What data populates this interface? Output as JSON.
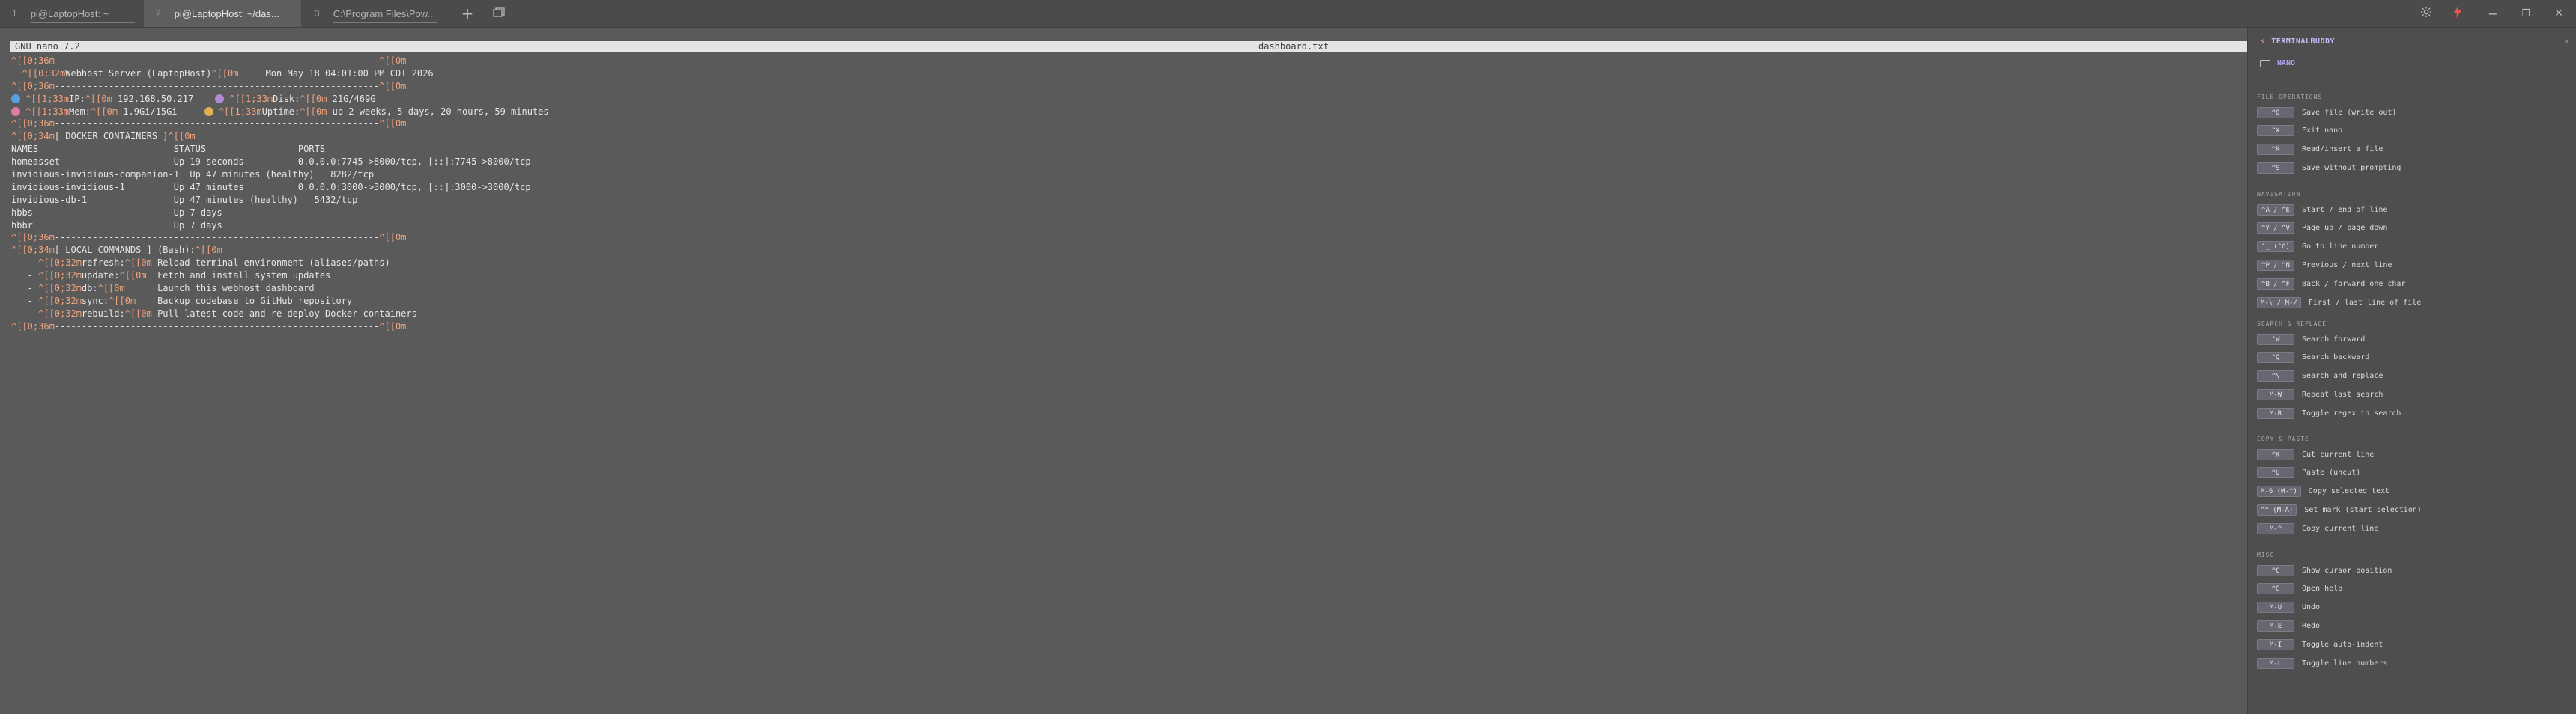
{
  "tabs": [
    {
      "num": "1",
      "title": "pi@LaptopHost: ~"
    },
    {
      "num": "2",
      "title": "pi@LaptopHost: ~/das..."
    },
    {
      "num": "3",
      "title": "C:\\Program Files\\Pow..."
    }
  ],
  "window": {
    "new_tab": "+",
    "minimize": "−",
    "maximize": "❐",
    "close": "✕"
  },
  "colors": {
    "escape_code": "#f2a37c",
    "accent_purple": "#b4a3f5",
    "bolt_orange": "#f0a26a",
    "terminal_bg": "#5a5a5a",
    "panel_bg": "#4e4e4e"
  },
  "nano": {
    "version": "GNU nano 7.2",
    "filename": "dashboard.txt"
  },
  "terminal_lines": [
    [
      {
        "t": "^[[0;36m",
        "e": 1
      },
      {
        "t": "------------------------------------------------------------"
      },
      {
        "t": "^[[0m",
        "e": 1
      }
    ],
    [
      {
        "t": "  ^[[0;32m",
        "e": 1
      },
      {
        "t": "Webhost Server (LaptopHost)"
      },
      {
        "t": "^[[0m",
        "e": 1
      },
      {
        "t": "     Mon May 18 04:01:00 PM CDT 2026"
      }
    ],
    [
      {
        "t": "^[[0;36m",
        "e": 1
      },
      {
        "t": "------------------------------------------------------------"
      },
      {
        "t": "^[[0m",
        "e": 1
      }
    ],
    [
      {
        "i": "#5aa0e0"
      },
      {
        "t": " "
      },
      {
        "t": "^[[1;33m",
        "e": 1
      },
      {
        "t": "IP:"
      },
      {
        "t": "^[[0m",
        "e": 1
      },
      {
        "t": " 192.168.50.217    "
      },
      {
        "i": "#b08ad0"
      },
      {
        "t": " "
      },
      {
        "t": "^[[1;33m",
        "e": 1
      },
      {
        "t": "Disk:"
      },
      {
        "t": "^[[0m",
        "e": 1
      },
      {
        "t": " 21G/469G"
      }
    ],
    [
      {
        "i": "#e07aa8"
      },
      {
        "t": " "
      },
      {
        "t": "^[[1;33m",
        "e": 1
      },
      {
        "t": "Mem:"
      },
      {
        "t": "^[[0m",
        "e": 1
      },
      {
        "t": " 1.9Gi/15Gi     "
      },
      {
        "i": "#e0b050"
      },
      {
        "t": " "
      },
      {
        "t": "^[[1;33m",
        "e": 1
      },
      {
        "t": "Uptime:"
      },
      {
        "t": "^[[0m",
        "e": 1
      },
      {
        "t": " up 2 weeks, 5 days, 20 hours, 59 minutes"
      }
    ],
    [
      {
        "t": "^[[0;36m",
        "e": 1
      },
      {
        "t": "------------------------------------------------------------"
      },
      {
        "t": "^[[0m",
        "e": 1
      }
    ],
    [
      {
        "t": "^[[0;34m",
        "e": 1
      },
      {
        "t": "[ DOCKER CONTAINERS ]"
      },
      {
        "t": "^[[0m",
        "e": 1
      }
    ],
    [
      {
        "t": "NAMES                         STATUS                 PORTS"
      }
    ],
    [
      {
        "t": "homeasset                     Up 19 seconds          0.0.0.0:7745->8000/tcp, [::]:7745->8000/tcp"
      }
    ],
    [
      {
        "t": "invidious-invidious-companion-1  Up 47 minutes (healthy)   8282/tcp"
      }
    ],
    [
      {
        "t": "invidious-invidious-1         Up 47 minutes          0.0.0.0:3000->3000/tcp, [::]:3000->3000/tcp"
      }
    ],
    [
      {
        "t": "invidious-db-1                Up 47 minutes (healthy)   5432/tcp"
      }
    ],
    [
      {
        "t": "hbbs                          Up 7 days"
      }
    ],
    [
      {
        "t": "hbbr                          Up 7 days"
      }
    ],
    [
      {
        "t": "^[[0;36m",
        "e": 1
      },
      {
        "t": "------------------------------------------------------------"
      },
      {
        "t": "^[[0m",
        "e": 1
      }
    ],
    [
      {
        "t": "^[[0;34m",
        "e": 1
      },
      {
        "t": "[ LOCAL COMMANDS ] (Bash):"
      },
      {
        "t": "^[[0m",
        "e": 1
      }
    ],
    [
      {
        "t": "   - "
      },
      {
        "t": "^[[0;32m",
        "e": 1
      },
      {
        "t": "refresh:"
      },
      {
        "t": "^[[0m",
        "e": 1
      },
      {
        "t": " Reload terminal environment (aliases/paths)"
      }
    ],
    [
      {
        "t": "   - "
      },
      {
        "t": "^[[0;32m",
        "e": 1
      },
      {
        "t": "update:"
      },
      {
        "t": "^[[0m",
        "e": 1
      },
      {
        "t": "  Fetch and install system updates"
      }
    ],
    [
      {
        "t": "   - "
      },
      {
        "t": "^[[0;32m",
        "e": 1
      },
      {
        "t": "db:"
      },
      {
        "t": "^[[0m",
        "e": 1
      },
      {
        "t": "      Launch this webhost dashboard"
      }
    ],
    [
      {
        "t": "   - "
      },
      {
        "t": "^[[0;32m",
        "e": 1
      },
      {
        "t": "sync:"
      },
      {
        "t": "^[[0m",
        "e": 1
      },
      {
        "t": "    Backup codebase to GitHub repository"
      }
    ],
    [
      {
        "t": "   - "
      },
      {
        "t": "^[[0;32m",
        "e": 1
      },
      {
        "t": "rebuild:"
      },
      {
        "t": "^[[0m",
        "e": 1
      },
      {
        "t": " Pull latest code and re-deploy Docker containers"
      }
    ],
    [
      {
        "t": "^[[0;36m",
        "e": 1
      },
      {
        "t": "------------------------------------------------------------"
      },
      {
        "t": "^[[0m",
        "e": 1
      }
    ]
  ],
  "panel": {
    "title": "TERMINALBUDDY",
    "close": "✕",
    "app": "NANO",
    "sections": [
      {
        "title": "FILE OPERATIONS",
        "items": [
          {
            "key": "^O",
            "desc": "Save file (write out)"
          },
          {
            "key": "^X",
            "desc": "Exit nano"
          },
          {
            "key": "^R",
            "desc": "Read/insert a file"
          },
          {
            "key": "^S",
            "desc": "Save without prompting"
          }
        ]
      },
      {
        "title": "NAVIGATION",
        "items": [
          {
            "key": "^A / ^E",
            "desc": "Start / end of line"
          },
          {
            "key": "^Y / ^V",
            "desc": "Page up / page down"
          },
          {
            "key": "^_ (^G)",
            "desc": "Go to line number"
          },
          {
            "key": "^P / ^N",
            "desc": "Previous / next line"
          },
          {
            "key": "^B / ^F",
            "desc": "Back / forward one char"
          },
          {
            "key": "M-\\ / M-/",
            "desc": "First / last line of file"
          }
        ]
      },
      {
        "title": "SEARCH & REPLACE",
        "items": [
          {
            "key": "^W",
            "desc": "Search forward"
          },
          {
            "key": "^Q",
            "desc": "Search backward"
          },
          {
            "key": "^\\",
            "desc": "Search and replace"
          },
          {
            "key": "M-W",
            "desc": "Repeat last search"
          },
          {
            "key": "M-R",
            "desc": "Toggle regex in search"
          }
        ]
      },
      {
        "title": "COPY & PASTE",
        "items": [
          {
            "key": "^K",
            "desc": "Cut current line"
          },
          {
            "key": "^U",
            "desc": "Paste (uncut)"
          },
          {
            "key": "M-6 (M-^)",
            "desc": "Copy selected text"
          },
          {
            "key": "^^ (M-A)",
            "desc": "Set mark (start selection)"
          },
          {
            "key": "M-^",
            "desc": "Copy current line"
          }
        ]
      },
      {
        "title": "MISC",
        "items": [
          {
            "key": "^C",
            "desc": "Show cursor position"
          },
          {
            "key": "^G",
            "desc": "Open help"
          },
          {
            "key": "M-U",
            "desc": "Undo"
          },
          {
            "key": "M-E",
            "desc": "Redo"
          },
          {
            "key": "M-I",
            "desc": "Toggle auto-indent"
          },
          {
            "key": "M-L",
            "desc": "Toggle line numbers"
          }
        ]
      }
    ]
  }
}
